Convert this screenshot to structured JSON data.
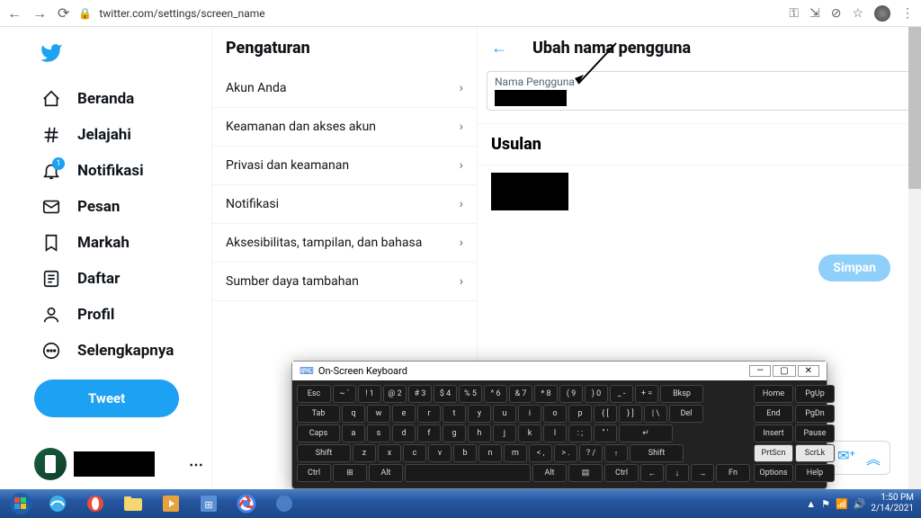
{
  "browser": {
    "url": "twitter.com/settings/screen_name"
  },
  "sidebar": {
    "items": [
      {
        "label": "Beranda"
      },
      {
        "label": "Jelajahi"
      },
      {
        "label": "Notifikasi",
        "badge": "1"
      },
      {
        "label": "Pesan"
      },
      {
        "label": "Markah"
      },
      {
        "label": "Daftar"
      },
      {
        "label": "Profil"
      },
      {
        "label": "Selengkapnya"
      }
    ],
    "tweet_label": "Tweet"
  },
  "settings": {
    "title": "Pengaturan",
    "items": [
      {
        "label": "Akun Anda"
      },
      {
        "label": "Keamanan dan akses akun"
      },
      {
        "label": "Privasi dan keamanan"
      },
      {
        "label": "Notifikasi"
      },
      {
        "label": "Aksesibilitas, tampilan, dan bahasa"
      },
      {
        "label": "Sumber daya tambahan"
      }
    ]
  },
  "content": {
    "title": "Ubah nama pengguna",
    "field_label": "Nama Pengguna",
    "section_title": "Usulan",
    "save_label": "Simpan"
  },
  "osk": {
    "title": "On-Screen Keyboard",
    "rows": {
      "r1": [
        "Esc",
        "~ `",
        "! 1",
        "@ 2",
        "# 3",
        "$ 4",
        "% 5",
        "^ 6",
        "& 7",
        "* 8",
        "( 9",
        ") 0",
        "_ -",
        "+ =",
        "Bksp"
      ],
      "r2": [
        "Tab",
        "q",
        "w",
        "e",
        "r",
        "t",
        "y",
        "u",
        "i",
        "o",
        "p",
        "{ [",
        "} ]",
        "| \\",
        "Del"
      ],
      "r3": [
        "Caps",
        "a",
        "s",
        "d",
        "f",
        "g",
        "h",
        "j",
        "k",
        "l",
        ": ;",
        "\" '",
        "↵"
      ],
      "r4": [
        "Shift",
        "z",
        "x",
        "c",
        "v",
        "b",
        "n",
        "m",
        "< ,",
        "> .",
        "? /",
        "↑",
        "Shift"
      ],
      "r5": [
        "Ctrl",
        "⊞",
        "Alt",
        "",
        "Alt",
        "▤",
        "Ctrl",
        "←",
        "↓",
        "→",
        "Fn"
      ]
    },
    "side": [
      [
        "Home",
        "PgUp"
      ],
      [
        "End",
        "PgDn"
      ],
      [
        "Insert",
        "Pause"
      ],
      [
        "PrtScn",
        "ScrLk"
      ],
      [
        "Options",
        "Help"
      ]
    ]
  },
  "taskbar": {
    "time": "1:50 PM",
    "date": "2/14/2021"
  }
}
